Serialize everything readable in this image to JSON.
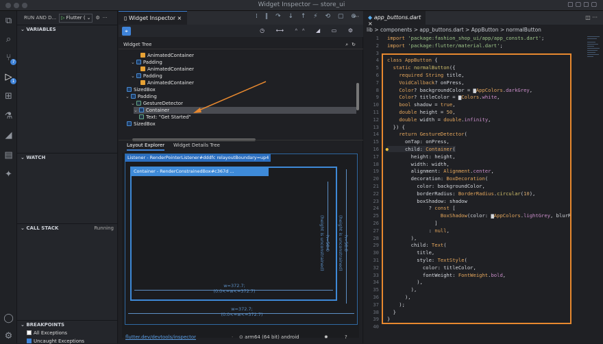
{
  "window": {
    "title": "Widget Inspector — store_ui"
  },
  "debug": {
    "run_label": "RUN AND D...",
    "config": "Flutter (",
    "variables": "VARIABLES",
    "watch": "WATCH",
    "call_stack": "CALL STACK",
    "call_stack_status": "Running",
    "breakpoints": "BREAKPOINTS",
    "bp_all": "All Exceptions",
    "bp_uncaught": "Uncaught Exceptions",
    "bp_all_checked": false,
    "bp_uncaught_checked": true
  },
  "inspector": {
    "tab_label": "Widget Inspector",
    "tree_header": "Widget Tree",
    "tree": [
      {
        "label": "AnimatedContainer",
        "kind": "orange"
      },
      {
        "label": "Padding",
        "kind": "blue"
      },
      {
        "label": "AnimatedContainer",
        "kind": "orange"
      },
      {
        "label": "Padding",
        "kind": "blue"
      },
      {
        "label": "AnimatedContainer",
        "kind": "orange"
      },
      {
        "label": "SizedBox",
        "kind": "blue"
      },
      {
        "label": "Padding",
        "kind": "blue"
      },
      {
        "label": "GestureDetector",
        "kind": "green"
      },
      {
        "label": "Container",
        "kind": "blue"
      },
      {
        "label": "Text: \"Get Started\"",
        "kind": "green"
      },
      {
        "label": "SizedBox",
        "kind": "blue"
      }
    ],
    "layout_tab": "Layout Explorer",
    "details_tab": "Widget Details Tree",
    "outer_header": "Listener - RenderPointerListener#dddfc relayoutBoundary=up4",
    "inner_header": "Container - RenderConstrainedBox#c367d ...",
    "inner_h": "h=50.0",
    "inner_h_c": "(height is unconstrained)",
    "outer_h": "h=50.0",
    "outer_h_c": "(height is unconstrained)",
    "inner_w": "w=372.7;",
    "inner_w_c": "(0.0<=w<=372.7)",
    "outer_w": "w=372.7;",
    "outer_w_c": "(0.0<=w<=372.7)",
    "status_link": "flutter.dev/devtools/inspector",
    "status_device": "arm64 (64 bit) android"
  },
  "editor": {
    "tab_label": "app_buttons.dart",
    "breadcrumb": "lib > components > app_buttons.dart > AppButton > normalButton"
  }
}
